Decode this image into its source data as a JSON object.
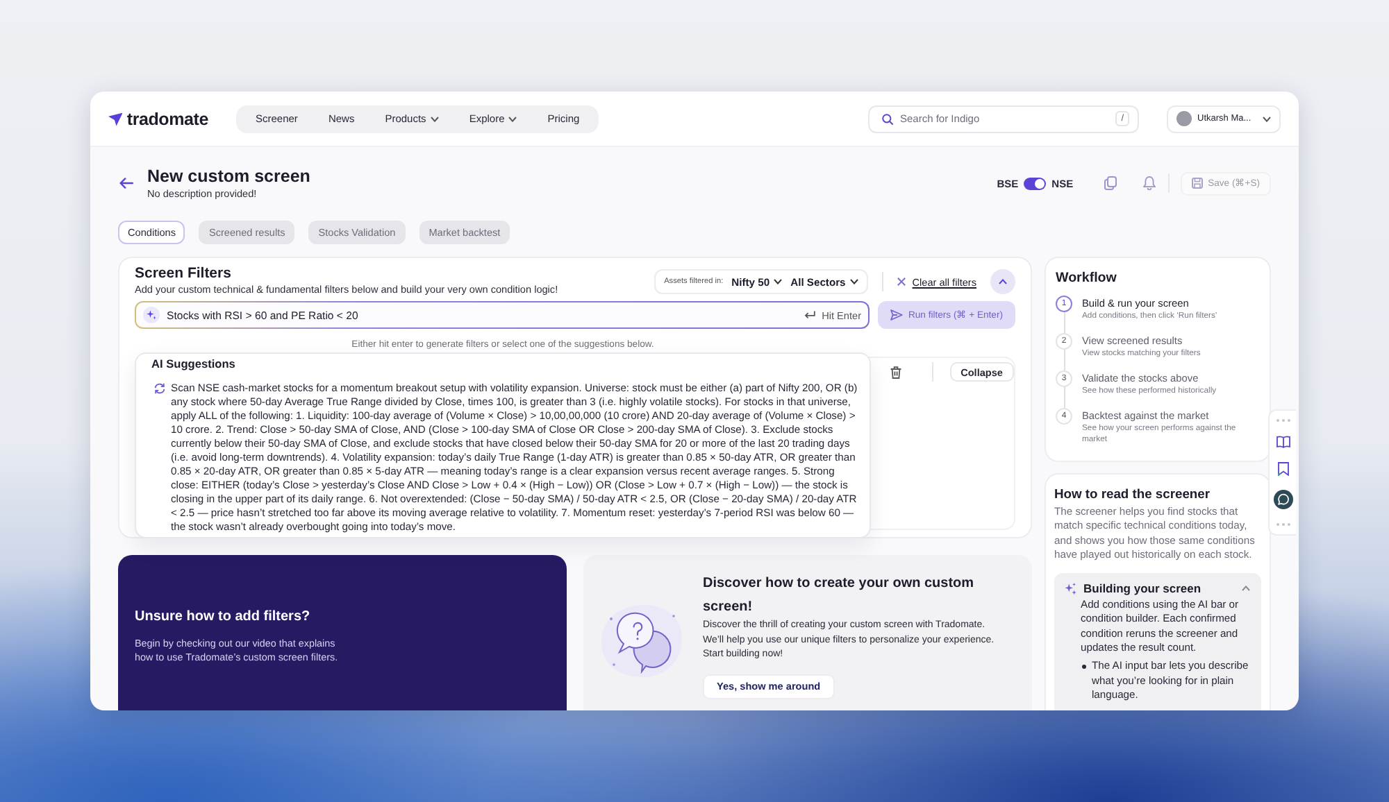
{
  "nav": {
    "logo": "tradomate",
    "links": [
      {
        "label": "Screener",
        "dropdown": false
      },
      {
        "label": "News",
        "dropdown": false
      },
      {
        "label": "Products",
        "dropdown": true
      },
      {
        "label": "Explore",
        "dropdown": true
      },
      {
        "label": "Pricing",
        "dropdown": false
      }
    ],
    "search": {
      "placeholder": "Search for Indigo",
      "shortcut": "/"
    },
    "user": {
      "name": "Utkarsh Ma..."
    }
  },
  "header": {
    "title": "New custom screen",
    "description": "No description provided!",
    "exchange": {
      "left": "BSE",
      "right": "NSE",
      "on": true
    },
    "save": "Save (⌘+S)"
  },
  "tabs": [
    {
      "label": "Conditions",
      "selected": true
    },
    {
      "label": "Screened results",
      "selected": false
    },
    {
      "label": "Stocks Validation",
      "selected": false
    },
    {
      "label": "Market backtest",
      "selected": false
    }
  ],
  "filters": {
    "title": "Screen Filters",
    "subtitle": "Add your custom technical & fundamental filters below and build your very own condition logic!",
    "assets_label": "Assets filtered in:",
    "index": "Nifty 50",
    "sectors": "All Sectors",
    "clear": "Clear all filters",
    "expanded": true,
    "ai_input": {
      "value": "Stocks with RSI > 60 and PE Ratio < 20",
      "hint": "Hit Enter"
    },
    "run_button": {
      "label": "Run filters (⌘ + Enter)",
      "disabled": true
    },
    "helper": "Either hit enter to generate filters or select one of the suggestions below.",
    "collapse": "Collapse",
    "suggestions": {
      "title": "AI Suggestions",
      "items": [
        "Scan NSE cash-market stocks for a momentum breakout setup with volatility expansion. Universe: stock must be either (a) part of Nifty 200, OR (b) any stock where 50-day Average True Range divided by Close, times 100, is greater than 3 (i.e. highly volatile stocks). For stocks in that universe, apply ALL of the following: 1. Liquidity: 100-day average of (Volume × Close) > 10,00,00,000 (10 crore) AND 20-day average of (Volume × Close) > 10 crore. 2. Trend: Close > 50-day SMA of Close, AND (Close > 100-day SMA of Close OR Close > 200-day SMA of Close). 3. Exclude stocks currently below their 50-day SMA of Close, and exclude stocks that have closed below their 50-day SMA for 20 or more of the last 20 trading days (i.e. avoid long-term downtrends). 4. Volatility expansion: today’s daily True Range (1-day ATR) is greater than 0.85 × 50-day ATR, OR greater than 0.85 × 20-day ATR, OR greater than 0.85 × 5-day ATR — meaning today’s range is a clear expansion versus recent average ranges. 5. Strong close: EITHER (today’s Close > yesterday’s Close AND Close > Low + 0.4 × (High − Low)) OR (Close > Low + 0.7 × (High − Low)) — the stock is closing in the upper part of its daily range. 6. Not overextended: (Close − 50-day SMA) / 50-day ATR < 2.5, OR (Close − 20-day SMA) / 20-day ATR < 2.5 — price hasn’t stretched too far above its moving average relative to volatility. 7. Momentum reset: yesterday’s 7-period RSI was below 60 — the stock wasn’t already overbought going into today’s move."
      ]
    }
  },
  "workflow": {
    "title": "Workflow",
    "steps": [
      {
        "number": "1",
        "title": "Build & run your screen",
        "description": "Add conditions, then click ‘Run filters’",
        "active": true
      },
      {
        "number": "2",
        "title": "View screened results",
        "description": "View stocks matching your filters",
        "active": false
      },
      {
        "number": "3",
        "title": "Validate the stocks above",
        "description": "See how these performed historically",
        "active": false
      },
      {
        "number": "4",
        "title": "Backtest against the market",
        "description": "See how your screen performs against the market",
        "active": false
      }
    ]
  },
  "guide": {
    "title": "How to read the screener",
    "intro": "The screener helps you find stocks that match specific technical conditions today, and shows you how those same conditions have played out historically on each stock.",
    "sections": [
      {
        "title": "Building your screen",
        "expanded": true,
        "body": "Add conditions using the AI bar or condition builder. Each confirmed condition reruns the screener and updates the result count.",
        "bullets": [
          "The AI input bar lets you describe what you’re looking for in plain language."
        ]
      }
    ]
  },
  "promo_cards": [
    {
      "kind": "dark",
      "title": "Unsure how to add filters?",
      "text": "Begin by checking out our video that explains how to use Tradomate’s custom screen filters."
    },
    {
      "kind": "light",
      "title": "Discover how to create your own custom screen!",
      "text": "Discover the thrill of creating your custom screen with Tradomate. We’ll help you use our unique filters to personalize your experience. Start building now!",
      "button": "Yes, show me around"
    }
  ]
}
